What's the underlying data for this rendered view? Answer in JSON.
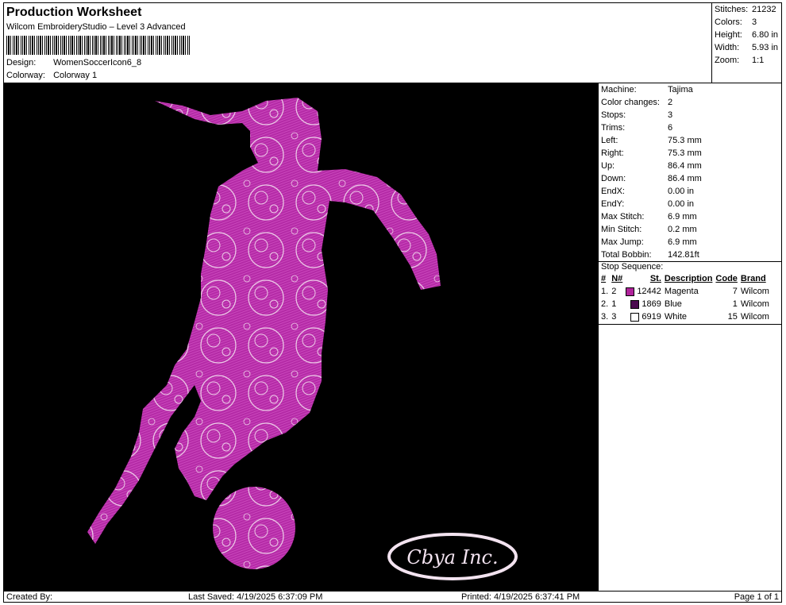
{
  "header": {
    "title": "Production Worksheet",
    "software": "Wilcom EmbroideryStudio – Level 3 Advanced",
    "design_label": "Design:",
    "design_value": "WomenSoccerIcon6_8",
    "colorway_label": "Colorway:",
    "colorway_value": "Colorway 1"
  },
  "stats": [
    {
      "label": "Stitches:",
      "value": "21232"
    },
    {
      "label": "Colors:",
      "value": "3"
    },
    {
      "label": "Height:",
      "value": "6.80 in"
    },
    {
      "label": "Width:",
      "value": "5.93 in"
    },
    {
      "label": "Zoom:",
      "value": "1:1"
    }
  ],
  "machine_info": [
    {
      "label": "Machine:",
      "value": "Tajima"
    },
    {
      "label": "Color changes:",
      "value": "2"
    },
    {
      "label": "Stops:",
      "value": "3"
    },
    {
      "label": "Trims:",
      "value": "6"
    },
    {
      "label": "Left:",
      "value": "75.3 mm"
    },
    {
      "label": "Right:",
      "value": "75.3 mm"
    },
    {
      "label": "Up:",
      "value": "86.4 mm"
    },
    {
      "label": "Down:",
      "value": "86.4 mm"
    },
    {
      "label": "EndX:",
      "value": "0.00 in"
    },
    {
      "label": "EndY:",
      "value": "0.00 in"
    },
    {
      "label": "Max Stitch:",
      "value": "6.9 mm"
    },
    {
      "label": "Min Stitch:",
      "value": "0.2 mm"
    },
    {
      "label": "Max Jump:",
      "value": "6.9 mm"
    },
    {
      "label": "Total Bobbin:",
      "value": "142.81ft"
    }
  ],
  "stop_sequence": {
    "title": "Stop Sequence:",
    "columns": [
      "#",
      "N#",
      "St.",
      "Description",
      "Code",
      "Brand"
    ],
    "rows": [
      {
        "num": "1.",
        "n": "2",
        "color": "#b0239b",
        "st": "12442",
        "desc": "Magenta",
        "code": "7",
        "brand": "Wilcom"
      },
      {
        "num": "2.",
        "n": "1",
        "color": "#4a0a4e",
        "st": "1869",
        "desc": "Blue",
        "code": "1",
        "brand": "Wilcom"
      },
      {
        "num": "3.",
        "n": "3",
        "color": "#ffffff",
        "st": "6919",
        "desc": "White",
        "code": "15",
        "brand": "Wilcom"
      }
    ]
  },
  "artwork": {
    "logo_text": "Cbya Inc.",
    "fill_color": "#b42aa6",
    "outline_color": "#f3e3f0"
  },
  "footer": {
    "created_by": "Created By:",
    "last_saved": "Last Saved: 4/19/2025 6:37:09 PM",
    "printed": "Printed: 4/19/2025 6:37:41 PM",
    "page": "Page 1 of 1"
  }
}
